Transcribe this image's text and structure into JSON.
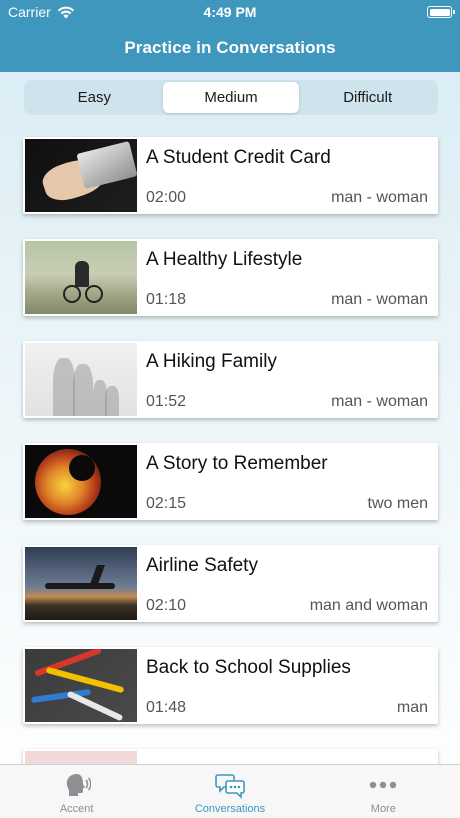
{
  "status_bar": {
    "carrier": "Carrier",
    "time": "4:49 PM"
  },
  "nav": {
    "title": "Practice in Conversations"
  },
  "segments": [
    {
      "label": "Easy",
      "active": false
    },
    {
      "label": "Medium",
      "active": true
    },
    {
      "label": "Difficult",
      "active": false
    }
  ],
  "conversations": [
    {
      "title": "A Student Credit Card",
      "duration": "02:00",
      "speakers": "man - woman"
    },
    {
      "title": "A Healthy Lifestyle",
      "duration": "01:18",
      "speakers": "man - woman"
    },
    {
      "title": "A Hiking Family",
      "duration": "01:52",
      "speakers": "man - woman"
    },
    {
      "title": "A Story to Remember",
      "duration": "02:15",
      "speakers": "two men"
    },
    {
      "title": "Airline Safety",
      "duration": "02:10",
      "speakers": "man and woman"
    },
    {
      "title": "Back to School Supplies",
      "duration": "01:48",
      "speakers": "man"
    }
  ],
  "tabbar": [
    {
      "label": "Accent",
      "icon": "speaking-head-icon",
      "active": false
    },
    {
      "label": "Conversations",
      "icon": "chat-bubbles-icon",
      "active": true
    },
    {
      "label": "More",
      "icon": "ellipsis-icon",
      "active": false
    }
  ],
  "colors": {
    "accent": "#3f97bd",
    "inactive": "#8e8e93"
  }
}
